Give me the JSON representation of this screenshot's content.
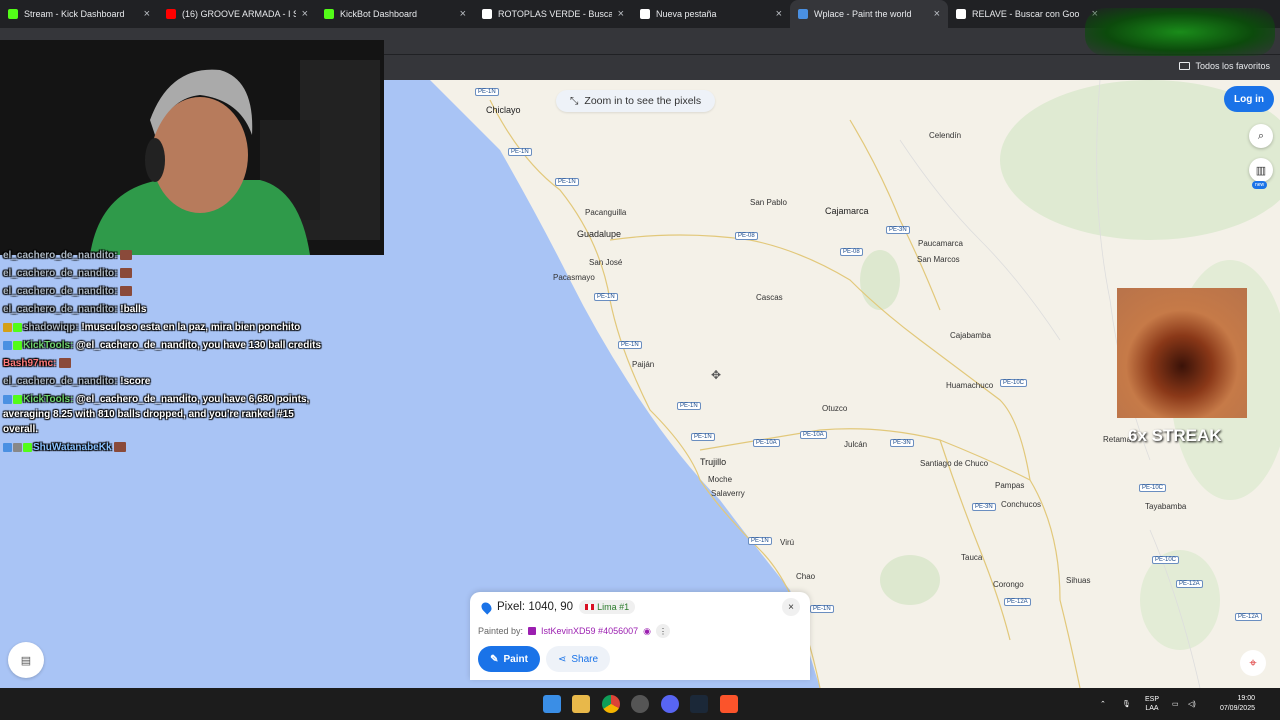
{
  "browser": {
    "tabs": [
      {
        "title": "Stream - Kick Dashboard",
        "icon": "kick-icon",
        "color": "#53fc18"
      },
      {
        "title": "(16) GROOVE ARMADA - I S",
        "icon": "youtube-icon",
        "color": "#ff0000"
      },
      {
        "title": "KickBot Dashboard",
        "icon": "kick-icon",
        "color": "#53fc18"
      },
      {
        "title": "ROTOPLAS VERDE - Buscar con",
        "icon": "google-icon",
        "color": "#ffffff"
      },
      {
        "title": "Nueva pestaña",
        "icon": "chrome-icon",
        "color": "#ffffff"
      },
      {
        "title": "Wplace - Paint the world",
        "icon": "wplace-icon",
        "color": "#4a90e2",
        "active": true
      },
      {
        "title": "RELAVE - Buscar con Goo",
        "icon": "google-icon",
        "color": "#ffffff"
      }
    ],
    "bookmarks_label": "Todos los favoritos"
  },
  "map": {
    "zoom_hint": "Zoom in to see the pixels",
    "login_label": "Log in",
    "new_badge": "new",
    "places": [
      {
        "name": "Chiclayo",
        "big": true
      },
      {
        "name": "Celendín"
      },
      {
        "name": "Pacanguilla"
      },
      {
        "name": "Guadalupe",
        "big": true
      },
      {
        "name": "San Pablo"
      },
      {
        "name": "Cajamarca",
        "big": true
      },
      {
        "name": "San José"
      },
      {
        "name": "Pacasmayo"
      },
      {
        "name": "Paucamarca"
      },
      {
        "name": "San Marcos"
      },
      {
        "name": "Cascas"
      },
      {
        "name": "Cajabamba"
      },
      {
        "name": "Paiján"
      },
      {
        "name": "Huamachuco"
      },
      {
        "name": "Otuzco"
      },
      {
        "name": "Retama"
      },
      {
        "name": "Julcán"
      },
      {
        "name": "Trujillo",
        "big": true
      },
      {
        "name": "Santiago de Chuco"
      },
      {
        "name": "Moche"
      },
      {
        "name": "Salaverry"
      },
      {
        "name": "Pampas"
      },
      {
        "name": "Conchucos"
      },
      {
        "name": "Tayabamba"
      },
      {
        "name": "Virú"
      },
      {
        "name": "Tauca"
      },
      {
        "name": "Chao"
      },
      {
        "name": "Corongo"
      },
      {
        "name": "Sihuas"
      }
    ],
    "roads": [
      "PE-1N",
      "PE-1N",
      "PE-1N",
      "PE-08",
      "PE-08",
      "PE-3N",
      "PE-1N",
      "PE-1N",
      "PE-10C",
      "PE-1N",
      "PE-1N",
      "PE-10A",
      "PE-10A",
      "PE-3N",
      "PE-10C",
      "PE-3N",
      "PE-1N",
      "PE-10C",
      "PE-12A",
      "PE-1N",
      "PE-12A",
      "PE-12A"
    ]
  },
  "pixel_card": {
    "pixel_text": "Pixel: 1040, 90",
    "region": "Lima #1",
    "painted_by_label": "Painted by:",
    "painter": "IstKevinXD59 #4056007",
    "paint_label": "Paint",
    "share_label": "Share",
    "close": "×"
  },
  "chat": [
    {
      "user": "el_cachero_de_nandito:",
      "text": "",
      "emote": true,
      "style": "grey"
    },
    {
      "user": "el_cachero_de_nandito:",
      "text": "",
      "emote": true,
      "style": "grey"
    },
    {
      "user": "el_cachero_de_nandito:",
      "text": "",
      "emote": true,
      "style": "grey"
    },
    {
      "user": "el_cachero_de_nandito:",
      "text": "!balls",
      "style": "grey"
    },
    {
      "user": "shadowiqp:",
      "text": "!musculoso esta en la paz, mira bien ponchito",
      "style": "grey",
      "badges": [
        "#d4a017",
        "#53fc18"
      ]
    },
    {
      "user": "KickTools:",
      "text": "@el_cachero_de_nandito, you have 130 ball credits",
      "style": "green",
      "badges": [
        "#4a90e2",
        "#53fc18"
      ]
    },
    {
      "user": "Bash97mc:",
      "text": "",
      "emote": true,
      "style": "red"
    },
    {
      "user": "el_cachero_de_nandito:",
      "text": "!score",
      "style": "grey"
    },
    {
      "user": "KickTools:",
      "text": "@el_cachero_de_nandito, you have 6,680 points, averaging 8.25 with 810 balls dropped, and you're ranked #15 overall.",
      "style": "green",
      "badges": [
        "#4a90e2",
        "#53fc18"
      ]
    },
    {
      "user": "ShuWatanabeKk",
      "text": "",
      "emote": true,
      "style": "blue",
      "badges": [
        "#4a90e2",
        "#888888",
        "#53fc18"
      ]
    }
  ],
  "streak": {
    "text": "6x STREAK"
  },
  "taskbar": {
    "lang_top": "ESP",
    "lang_bottom": "LAA",
    "time": "19:00",
    "date": "07/09/2025"
  }
}
